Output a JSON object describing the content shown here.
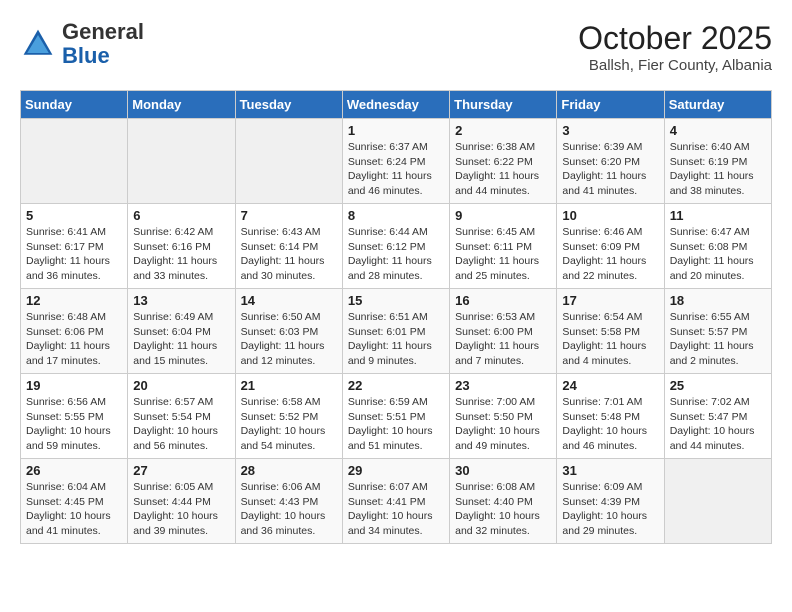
{
  "header": {
    "logo_line1": "General",
    "logo_line2": "Blue",
    "month": "October 2025",
    "location": "Ballsh, Fier County, Albania"
  },
  "weekdays": [
    "Sunday",
    "Monday",
    "Tuesday",
    "Wednesday",
    "Thursday",
    "Friday",
    "Saturday"
  ],
  "weeks": [
    [
      {
        "day": "",
        "info": ""
      },
      {
        "day": "",
        "info": ""
      },
      {
        "day": "",
        "info": ""
      },
      {
        "day": "1",
        "info": "Sunrise: 6:37 AM\nSunset: 6:24 PM\nDaylight: 11 hours and 46 minutes."
      },
      {
        "day": "2",
        "info": "Sunrise: 6:38 AM\nSunset: 6:22 PM\nDaylight: 11 hours and 44 minutes."
      },
      {
        "day": "3",
        "info": "Sunrise: 6:39 AM\nSunset: 6:20 PM\nDaylight: 11 hours and 41 minutes."
      },
      {
        "day": "4",
        "info": "Sunrise: 6:40 AM\nSunset: 6:19 PM\nDaylight: 11 hours and 38 minutes."
      }
    ],
    [
      {
        "day": "5",
        "info": "Sunrise: 6:41 AM\nSunset: 6:17 PM\nDaylight: 11 hours and 36 minutes."
      },
      {
        "day": "6",
        "info": "Sunrise: 6:42 AM\nSunset: 6:16 PM\nDaylight: 11 hours and 33 minutes."
      },
      {
        "day": "7",
        "info": "Sunrise: 6:43 AM\nSunset: 6:14 PM\nDaylight: 11 hours and 30 minutes."
      },
      {
        "day": "8",
        "info": "Sunrise: 6:44 AM\nSunset: 6:12 PM\nDaylight: 11 hours and 28 minutes."
      },
      {
        "day": "9",
        "info": "Sunrise: 6:45 AM\nSunset: 6:11 PM\nDaylight: 11 hours and 25 minutes."
      },
      {
        "day": "10",
        "info": "Sunrise: 6:46 AM\nSunset: 6:09 PM\nDaylight: 11 hours and 22 minutes."
      },
      {
        "day": "11",
        "info": "Sunrise: 6:47 AM\nSunset: 6:08 PM\nDaylight: 11 hours and 20 minutes."
      }
    ],
    [
      {
        "day": "12",
        "info": "Sunrise: 6:48 AM\nSunset: 6:06 PM\nDaylight: 11 hours and 17 minutes."
      },
      {
        "day": "13",
        "info": "Sunrise: 6:49 AM\nSunset: 6:04 PM\nDaylight: 11 hours and 15 minutes."
      },
      {
        "day": "14",
        "info": "Sunrise: 6:50 AM\nSunset: 6:03 PM\nDaylight: 11 hours and 12 minutes."
      },
      {
        "day": "15",
        "info": "Sunrise: 6:51 AM\nSunset: 6:01 PM\nDaylight: 11 hours and 9 minutes."
      },
      {
        "day": "16",
        "info": "Sunrise: 6:53 AM\nSunset: 6:00 PM\nDaylight: 11 hours and 7 minutes."
      },
      {
        "day": "17",
        "info": "Sunrise: 6:54 AM\nSunset: 5:58 PM\nDaylight: 11 hours and 4 minutes."
      },
      {
        "day": "18",
        "info": "Sunrise: 6:55 AM\nSunset: 5:57 PM\nDaylight: 11 hours and 2 minutes."
      }
    ],
    [
      {
        "day": "19",
        "info": "Sunrise: 6:56 AM\nSunset: 5:55 PM\nDaylight: 10 hours and 59 minutes."
      },
      {
        "day": "20",
        "info": "Sunrise: 6:57 AM\nSunset: 5:54 PM\nDaylight: 10 hours and 56 minutes."
      },
      {
        "day": "21",
        "info": "Sunrise: 6:58 AM\nSunset: 5:52 PM\nDaylight: 10 hours and 54 minutes."
      },
      {
        "day": "22",
        "info": "Sunrise: 6:59 AM\nSunset: 5:51 PM\nDaylight: 10 hours and 51 minutes."
      },
      {
        "day": "23",
        "info": "Sunrise: 7:00 AM\nSunset: 5:50 PM\nDaylight: 10 hours and 49 minutes."
      },
      {
        "day": "24",
        "info": "Sunrise: 7:01 AM\nSunset: 5:48 PM\nDaylight: 10 hours and 46 minutes."
      },
      {
        "day": "25",
        "info": "Sunrise: 7:02 AM\nSunset: 5:47 PM\nDaylight: 10 hours and 44 minutes."
      }
    ],
    [
      {
        "day": "26",
        "info": "Sunrise: 6:04 AM\nSunset: 4:45 PM\nDaylight: 10 hours and 41 minutes."
      },
      {
        "day": "27",
        "info": "Sunrise: 6:05 AM\nSunset: 4:44 PM\nDaylight: 10 hours and 39 minutes."
      },
      {
        "day": "28",
        "info": "Sunrise: 6:06 AM\nSunset: 4:43 PM\nDaylight: 10 hours and 36 minutes."
      },
      {
        "day": "29",
        "info": "Sunrise: 6:07 AM\nSunset: 4:41 PM\nDaylight: 10 hours and 34 minutes."
      },
      {
        "day": "30",
        "info": "Sunrise: 6:08 AM\nSunset: 4:40 PM\nDaylight: 10 hours and 32 minutes."
      },
      {
        "day": "31",
        "info": "Sunrise: 6:09 AM\nSunset: 4:39 PM\nDaylight: 10 hours and 29 minutes."
      },
      {
        "day": "",
        "info": ""
      }
    ]
  ]
}
